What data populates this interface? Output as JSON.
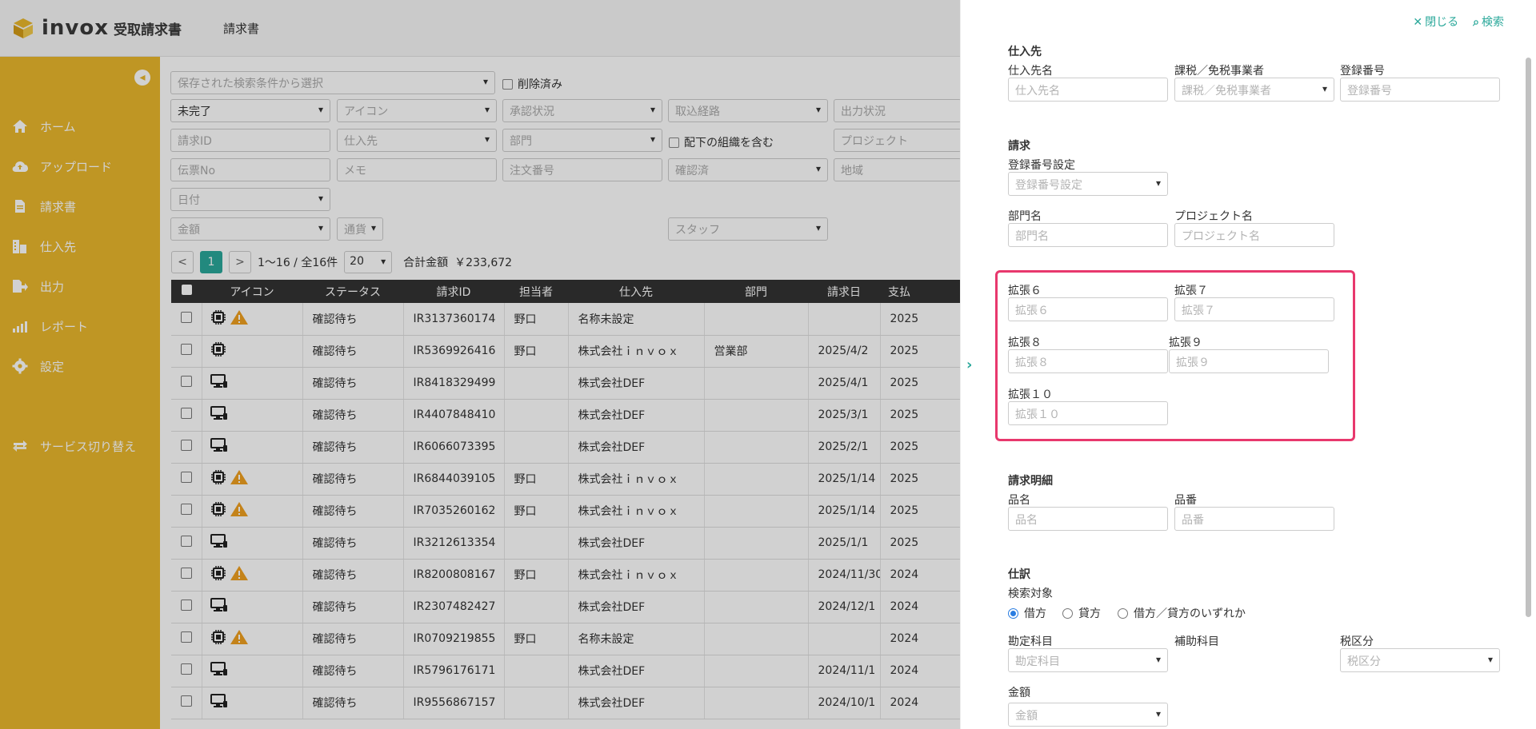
{
  "app": {
    "logo_text": "invox",
    "logo_sub": "受取請求書",
    "header_menu": "請求書"
  },
  "sidebar": {
    "items": [
      {
        "label": "ホーム",
        "icon": "home-icon"
      },
      {
        "label": "アップロード",
        "icon": "cloud-upload-icon"
      },
      {
        "label": "請求書",
        "icon": "document-icon"
      },
      {
        "label": "仕入先",
        "icon": "building-icon"
      },
      {
        "label": "出力",
        "icon": "export-icon"
      },
      {
        "label": "レポート",
        "icon": "chart-icon"
      },
      {
        "label": "設定",
        "icon": "gear-icon"
      }
    ],
    "service_switch": "サービス切り替え"
  },
  "filters": {
    "saved_search": "保存された検索条件から選択",
    "deleted": "削除済み",
    "status": "未完了",
    "icon": "アイコン",
    "approval": "承認状況",
    "intake_route": "取込経路",
    "output_status": "出力状況",
    "invoice_id": "請求ID",
    "supplier": "仕入先",
    "department": "部門",
    "include_sub": "配下の組織を含む",
    "project": "プロジェクト",
    "voucher_no": "伝票No",
    "memo": "メモ",
    "order_no": "注文番号",
    "confirmed": "確認済",
    "region": "地域",
    "date": "日付",
    "amount": "金額",
    "currency": "通貨",
    "staff": "スタッフ"
  },
  "pager": {
    "prev": "<",
    "page": "1",
    "next": ">",
    "range": "1〜16 / 全16件",
    "per_page": "20",
    "total_label": "合計金額",
    "total_value": "￥233,672"
  },
  "table": {
    "headers": [
      "アイコン",
      "ステータス",
      "請求ID",
      "担当者",
      "仕入先",
      "部門",
      "請求日",
      "支払"
    ],
    "rows": [
      {
        "icon": "chip-warn",
        "status": "確認待ち",
        "id": "IR3137360174",
        "owner": "野口",
        "supplier": "名称未設定",
        "dept": "",
        "date": "",
        "pay": "2025"
      },
      {
        "icon": "chip",
        "status": "確認待ち",
        "id": "IR5369926416",
        "owner": "野口",
        "supplier": "株式会社ｉｎｖｏｘ",
        "dept": "営業部",
        "date": "2025/4/2",
        "pay": "2025"
      },
      {
        "icon": "monitor",
        "status": "確認待ち",
        "id": "IR8418329499",
        "owner": "",
        "supplier": "株式会社DEF",
        "dept": "",
        "date": "2025/4/1",
        "pay": "2025"
      },
      {
        "icon": "monitor",
        "status": "確認待ち",
        "id": "IR4407848410",
        "owner": "",
        "supplier": "株式会社DEF",
        "dept": "",
        "date": "2025/3/1",
        "pay": "2025"
      },
      {
        "icon": "monitor",
        "status": "確認待ち",
        "id": "IR6066073395",
        "owner": "",
        "supplier": "株式会社DEF",
        "dept": "",
        "date": "2025/2/1",
        "pay": "2025"
      },
      {
        "icon": "chip-warn",
        "status": "確認待ち",
        "id": "IR6844039105",
        "owner": "野口",
        "supplier": "株式会社ｉｎｖｏｘ",
        "dept": "",
        "date": "2025/1/14",
        "pay": "2025"
      },
      {
        "icon": "chip-warn",
        "status": "確認待ち",
        "id": "IR7035260162",
        "owner": "野口",
        "supplier": "株式会社ｉｎｖｏｘ",
        "dept": "",
        "date": "2025/1/14",
        "pay": "2025"
      },
      {
        "icon": "monitor",
        "status": "確認待ち",
        "id": "IR3212613354",
        "owner": "",
        "supplier": "株式会社DEF",
        "dept": "",
        "date": "2025/1/1",
        "pay": "2025"
      },
      {
        "icon": "chip-warn",
        "status": "確認待ち",
        "id": "IR8200808167",
        "owner": "野口",
        "supplier": "株式会社ｉｎｖｏｘ",
        "dept": "",
        "date": "2024/11/30",
        "pay": "2024"
      },
      {
        "icon": "monitor",
        "status": "確認待ち",
        "id": "IR2307482427",
        "owner": "",
        "supplier": "株式会社DEF",
        "dept": "",
        "date": "2024/12/1",
        "pay": "2024"
      },
      {
        "icon": "chip-warn",
        "status": "確認待ち",
        "id": "IR0709219855",
        "owner": "野口",
        "supplier": "名称未設定",
        "dept": "",
        "date": "",
        "pay": "2024"
      },
      {
        "icon": "monitor",
        "status": "確認待ち",
        "id": "IR5796176171",
        "owner": "",
        "supplier": "株式会社DEF",
        "dept": "",
        "date": "2024/11/1",
        "pay": "2024"
      },
      {
        "icon": "monitor",
        "status": "確認待ち",
        "id": "IR9556867157",
        "owner": "",
        "supplier": "株式会社DEF",
        "dept": "",
        "date": "2024/10/1",
        "pay": "2024"
      }
    ]
  },
  "drawer": {
    "close": "閉じる",
    "search": "検索",
    "supplier_section": "仕入先",
    "supplier_name_label": "仕入先名",
    "supplier_name_ph": "仕入先名",
    "tax_label": "課税／免税事業者",
    "tax_ph": "課税／免税事業者",
    "reg_no_label": "登録番号",
    "reg_no_ph": "登録番号",
    "invoice_section": "請求",
    "reg_setting_label": "登録番号設定",
    "reg_setting_ph": "登録番号設定",
    "dept_label": "部門名",
    "dept_ph": "部門名",
    "project_label": "プロジェクト名",
    "project_ph": "プロジェクト名",
    "ext6_label": "拡張６",
    "ext6_ph": "拡張６",
    "ext7_label": "拡張７",
    "ext7_ph": "拡張７",
    "ext8_label": "拡張８",
    "ext8_ph": "拡張８",
    "ext9_label": "拡張９",
    "ext9_ph": "拡張９",
    "ext10_label": "拡張１０",
    "ext10_ph": "拡張１０",
    "detail_section": "請求明細",
    "item_name_label": "品名",
    "item_name_ph": "品名",
    "item_no_label": "品番",
    "item_no_ph": "品番",
    "journal_section": "仕訳",
    "search_target_label": "検索対象",
    "radio_debit": "借方",
    "radio_credit": "貸方",
    "radio_either": "借方／貸方のいずれか",
    "account_label": "勘定科目",
    "account_ph": "勘定科目",
    "sub_account_label": "補助科目",
    "tax_class_label": "税区分",
    "tax_class_ph": "税区分",
    "amount_label": "金額",
    "amount_ph": "金額"
  },
  "colors": {
    "sidebar": "#e9b72c",
    "accent": "#2aa89a",
    "highlight": "#e8386d"
  }
}
